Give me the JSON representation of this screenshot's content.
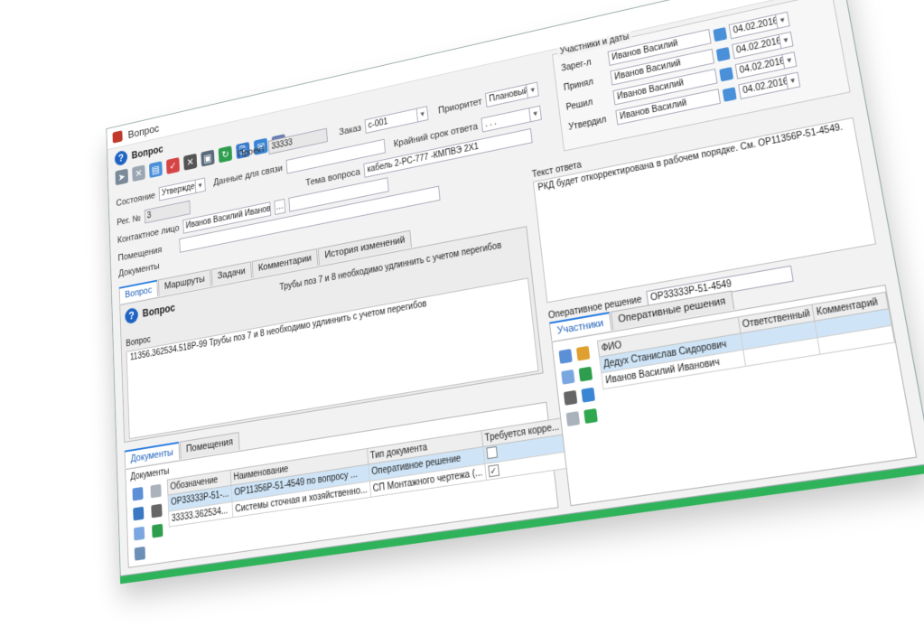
{
  "window": {
    "title": "Вопрос",
    "minimize": "—",
    "maximize": "▢",
    "close": "✕"
  },
  "header": {
    "title": "Вопрос",
    "icon": "question-circle-icon"
  },
  "toolbar": {
    "icons": [
      "send-icon",
      "delete-icon",
      "document-icon",
      "approve-icon",
      "cancel-icon",
      "save-icon",
      "refresh-icon",
      "link-icon",
      "email-icon",
      "export-icon"
    ]
  },
  "form": {
    "reg_no": {
      "label": "Рег. №",
      "value": "3"
    },
    "state": {
      "label": "Состояние",
      "value": "Утвержден"
    },
    "project": {
      "label": "Проект",
      "value": "33333"
    },
    "order": {
      "label": "Заказ",
      "value": "c-001"
    },
    "priority": {
      "label": "Приоритет",
      "value": "Плановый"
    },
    "contact_data": {
      "label": "Данные для связи",
      "value": ""
    },
    "deadline": {
      "label": "Крайний срок ответа",
      "value": ". . ."
    },
    "contact_person": {
      "label": "Контактное лицо",
      "value": "Иванов Василий Иванов"
    },
    "topic": {
      "label": "Тема вопроса",
      "value": "кабель 2-РС-777 -КМПВЭ 2Х1"
    },
    "rooms": {
      "label": "Помещения",
      "value": ""
    },
    "documents": {
      "label": "Документы",
      "value": ""
    }
  },
  "participants": {
    "group_label": "Участники и даты",
    "rows": [
      {
        "label": "Зарег-л",
        "name": "Иванов Василий Иванович",
        "date": "04.02.2016"
      },
      {
        "label": "Принял",
        "name": "Иванов Василий Иванович",
        "date": "04.02.2016"
      },
      {
        "label": "Решил",
        "name": "Иванов Василий Иванович",
        "date": "04.02.2016"
      },
      {
        "label": "Утвердил",
        "name": "Иванов Василий Иванович",
        "date": "04.02.2016"
      }
    ]
  },
  "tabs_main": [
    "Вопрос",
    "Маршруты",
    "Задачи",
    "Комментарии",
    "История изменений"
  ],
  "question": {
    "header": "Вопрос",
    "text": "Трубы поз 7 и 8 необходимо удлиннить с учетом перегибов",
    "label": "Вопрос",
    "value": "11356.362534.518Р-99 Трубы поз 7 и 8 необходимо удлиннить с учетом перегибов"
  },
  "answer": {
    "label": "Текст ответа",
    "value": "РКД будет откорректирована в рабочем порядке. См. ОР11356Р-51-4549.",
    "op_decision_label": "Оперативное решение",
    "op_decision_value": "ОР33333Р-51-4549"
  },
  "bottom_left": {
    "tabs": [
      "Документы",
      "Помещения"
    ],
    "grid_title": "Документы",
    "columns": [
      "Обозначение",
      "Наименование",
      "Тип документа",
      "Требуется корре..."
    ],
    "rows": [
      {
        "code": "ОР33333Р-51-...",
        "name": "ОР11356Р-51-4549 по вопросу ...",
        "type": "Оперативное решение",
        "check": ""
      },
      {
        "code": "33333.362534...",
        "name": "Системы сточная и хозяйственно...",
        "type": "СП Монтажного чертежа (...",
        "check": "✓"
      }
    ]
  },
  "bottom_right": {
    "tabs": [
      "Участники",
      "Оперативные решения",
      "Ответственный",
      "Комментарий"
    ],
    "columns": [
      "ФИО"
    ],
    "rows": [
      {
        "name": "Дедух Станислав Сидорович"
      },
      {
        "name": "Иванов Василий Иванович"
      }
    ]
  }
}
